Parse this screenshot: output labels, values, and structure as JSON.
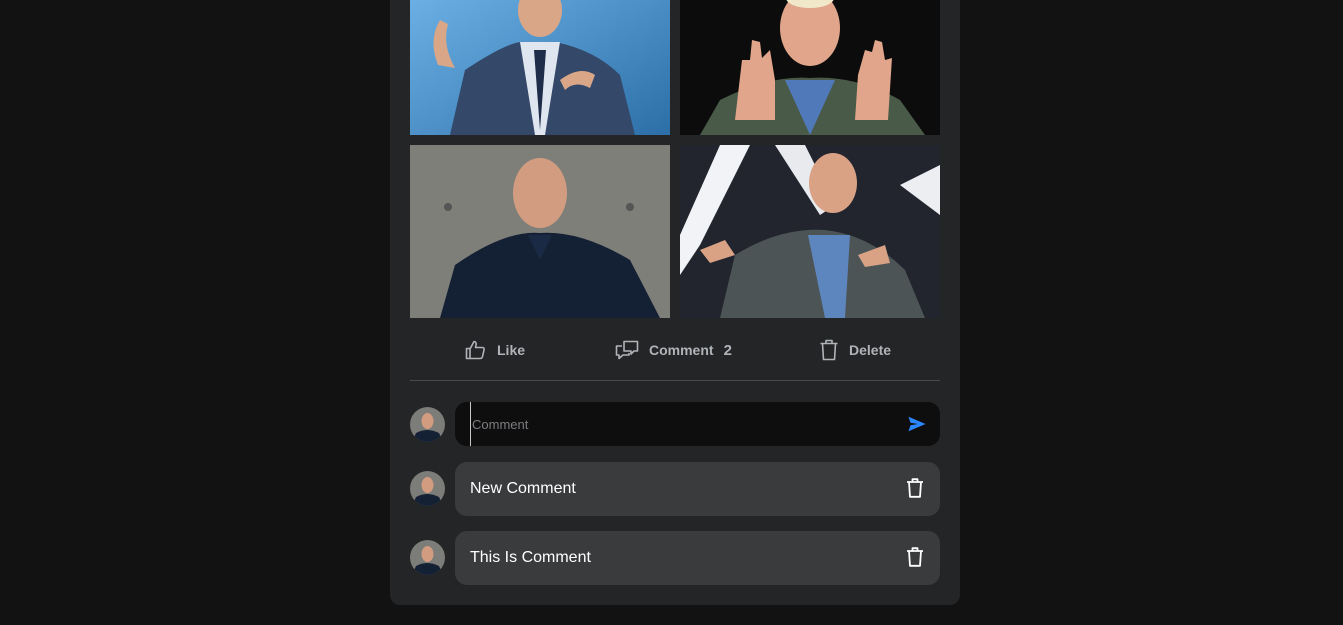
{
  "post": {
    "photos": [
      {
        "alt": "Jeff Bezos on stage"
      },
      {
        "alt": "Jeff Bezos gesturing"
      },
      {
        "alt": "Jeff Bezos portrait"
      },
      {
        "alt": "Jeff Bezos seated"
      }
    ],
    "actions": {
      "like_label": "Like",
      "comment_label": "Comment",
      "comment_count": "2",
      "delete_label": "Delete"
    },
    "comment_input": {
      "placeholder": "Comment",
      "value": ""
    },
    "comments": [
      {
        "text": "New Comment"
      },
      {
        "text": "This Is Comment"
      }
    ]
  },
  "colors": {
    "page_bg": "#121212",
    "card_bg": "#242526",
    "bubble_bg": "#3a3b3c",
    "input_bg": "#0e0e0f",
    "accent": "#2d88ff",
    "muted_text": "#b0b3b8"
  },
  "icons": [
    "like-icon",
    "comment-icon",
    "trash-icon",
    "send-icon"
  ]
}
